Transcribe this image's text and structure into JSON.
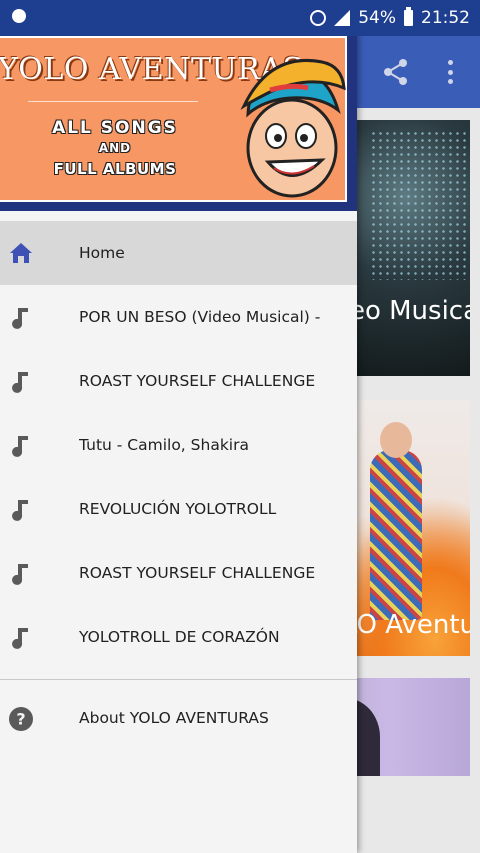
{
  "status": {
    "battery": "54%",
    "time": "21:52"
  },
  "header": {
    "brand": "YOLO AVENTURAS",
    "line1": "ALL SONGS",
    "line2": "AND",
    "line3": "FULL ALBUMS"
  },
  "nav": {
    "items": [
      {
        "label": "Home",
        "icon": "home-icon"
      },
      {
        "label": "POR UN BESO (Video Musical) -",
        "icon": "music-note-icon"
      },
      {
        "label": "ROAST YOURSELF CHALLENGE",
        "icon": "music-note-icon"
      },
      {
        "label": "Tutu - Camilo, Shakira",
        "icon": "music-note-icon"
      },
      {
        "label": "REVOLUCIÓN YOLOTROLL",
        "icon": "music-note-icon"
      },
      {
        "label": "ROAST YOURSELF CHALLENGE",
        "icon": "music-note-icon"
      },
      {
        "label": "YOLOTROLL DE CORAZÓN",
        "icon": "music-note-icon"
      }
    ],
    "about": {
      "label": "About YOLO AVENTURAS",
      "icon": "help-icon"
    }
  },
  "background": {
    "card1_title": "Video Musical)",
    "card2_title": "YOLO Aventuras"
  },
  "colors": {
    "status_bar": "#1e3e90",
    "app_bar": "#3a5db8",
    "banner": "#f79763",
    "home_icon": "#3f51b5"
  }
}
